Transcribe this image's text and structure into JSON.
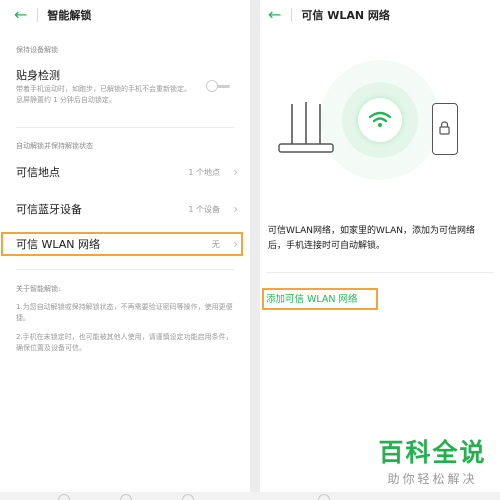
{
  "left_screen": {
    "back_icon": "arrow-left-icon",
    "title": "智能解锁",
    "section_keep_unlocked": "保持设备解锁",
    "body_detection": {
      "label": "贴身检测",
      "description": "带着手机运动时，如跑步，已解锁的手机不会重新锁定。息屏静置约 1 分钟后自动锁定。"
    },
    "section_auto_unlock": "自动解锁并保持解锁状态",
    "rows": [
      {
        "label": "可信地点",
        "value": "1 个地点"
      },
      {
        "label": "可信蓝牙设备",
        "value": "1 个设备"
      },
      {
        "label": "可信 WLAN 网络",
        "value": "无"
      }
    ],
    "about_title": "关于智能解锁:",
    "about_notes": [
      "1.为您自动解锁或保持解锁状态，不再需要验证密码等操作，使用更便捷。",
      "2.手机在未锁定时，也可能被其他人使用，请谨慎设定功能启用条件，确保位置及设备可信。"
    ]
  },
  "right_screen": {
    "back_icon": "arrow-left-icon",
    "title": "可信 WLAN 网络",
    "description": "可信WLAN网络，如家里的WLAN，添加为可信网络后，手机连接时可自动解锁。",
    "add_link": "添加可信 WLAN 网络"
  },
  "watermark": {
    "title": "百科全说",
    "subtitle": "助你轻松解决"
  },
  "colors": {
    "accent": "#1db954",
    "highlight": "#f3a43a",
    "watermark_green": "#22b14c"
  }
}
